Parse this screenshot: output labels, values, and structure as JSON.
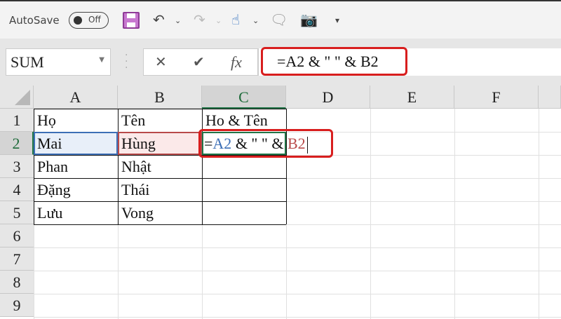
{
  "toolbar": {
    "autosave_label": "AutoSave",
    "autosave_state": "Off"
  },
  "namebox": {
    "value": "SUM"
  },
  "formula": {
    "value": "=A2 & \" \" & B2",
    "icons": [
      "cancel-icon",
      "enter-icon",
      "fx-icon"
    ],
    "fx_label": "fx"
  },
  "columns": [
    "A",
    "B",
    "C",
    "D",
    "E",
    "F"
  ],
  "rows": [
    "1",
    "2",
    "3",
    "4",
    "5",
    "6",
    "7",
    "8",
    "9"
  ],
  "cells": {
    "A1": "Họ",
    "B1": "Tên",
    "C1": "Ho & Tên",
    "A2": "Mai",
    "B2": "Hùng",
    "A3": "Phan",
    "B3": "Nhật",
    "A4": "Đặng",
    "B4": "Thái",
    "A5": "Lưu",
    "B5": "Vong"
  },
  "edit": {
    "eq": "=",
    "ref1": "A2",
    "mid": " & \" \" & ",
    "ref2": "B2"
  },
  "colors": {
    "ref1": "#3c6fb6",
    "ref2": "#b84a4a",
    "highlight": "#d81e1e",
    "accent": "#217346"
  }
}
